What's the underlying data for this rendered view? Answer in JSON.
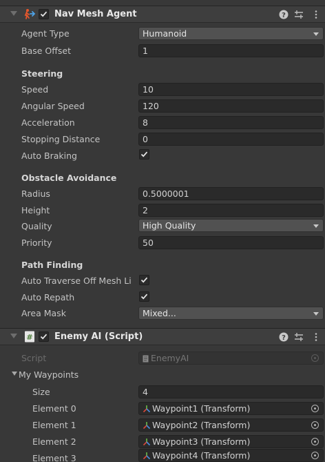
{
  "nav_mesh_agent": {
    "title": "Nav Mesh Agent",
    "agent_type": {
      "label": "Agent Type",
      "value": "Humanoid"
    },
    "base_offset": {
      "label": "Base Offset",
      "value": "1"
    },
    "steering": {
      "title": "Steering",
      "speed": {
        "label": "Speed",
        "value": "10"
      },
      "angular_speed": {
        "label": "Angular Speed",
        "value": "120"
      },
      "acceleration": {
        "label": "Acceleration",
        "value": "8"
      },
      "stopping_distance": {
        "label": "Stopping Distance",
        "value": "0"
      },
      "auto_braking": {
        "label": "Auto Braking",
        "checked": true
      }
    },
    "obstacle_avoidance": {
      "title": "Obstacle Avoidance",
      "radius": {
        "label": "Radius",
        "value": "0.5000001"
      },
      "height": {
        "label": "Height",
        "value": "2"
      },
      "quality": {
        "label": "Quality",
        "value": "High Quality"
      },
      "priority": {
        "label": "Priority",
        "value": "50"
      }
    },
    "path_finding": {
      "title": "Path Finding",
      "auto_traverse": {
        "label": "Auto Traverse Off Mesh Li",
        "checked": true
      },
      "auto_repath": {
        "label": "Auto Repath",
        "checked": true
      },
      "area_mask": {
        "label": "Area Mask",
        "value": "Mixed..."
      }
    }
  },
  "enemy_ai": {
    "title": "Enemy AI (Script)",
    "script": {
      "label": "Script",
      "value": "EnemyAI"
    },
    "my_waypoints": {
      "label": "My Waypoints",
      "size": {
        "label": "Size",
        "value": "4"
      },
      "elements": [
        {
          "label": "Element 0",
          "value": "Waypoint1 (Transform)"
        },
        {
          "label": "Element 1",
          "value": "Waypoint2 (Transform)"
        },
        {
          "label": "Element 2",
          "value": "Waypoint3 (Transform)"
        },
        {
          "label": "Element 3",
          "value": "Waypoint4 (Transform)"
        }
      ]
    }
  },
  "colors": {
    "background": "#383838",
    "header": "#3e3e3e",
    "field": "#2a2a2a",
    "dropdown": "#515151",
    "navmesh_icon_accent": "#e8572c",
    "transform_icon_red": "#d9493a",
    "transform_icon_green": "#6bbf4a",
    "transform_icon_blue": "#4a8ee0"
  },
  "icons": {
    "navmesh": "nav-mesh-agent-icon",
    "script": "csharp-script-icon",
    "help": "help-icon",
    "presets": "presets-icon",
    "more": "kebab-menu-icon",
    "transform": "transform-icon",
    "object_picker": "object-picker-icon"
  }
}
